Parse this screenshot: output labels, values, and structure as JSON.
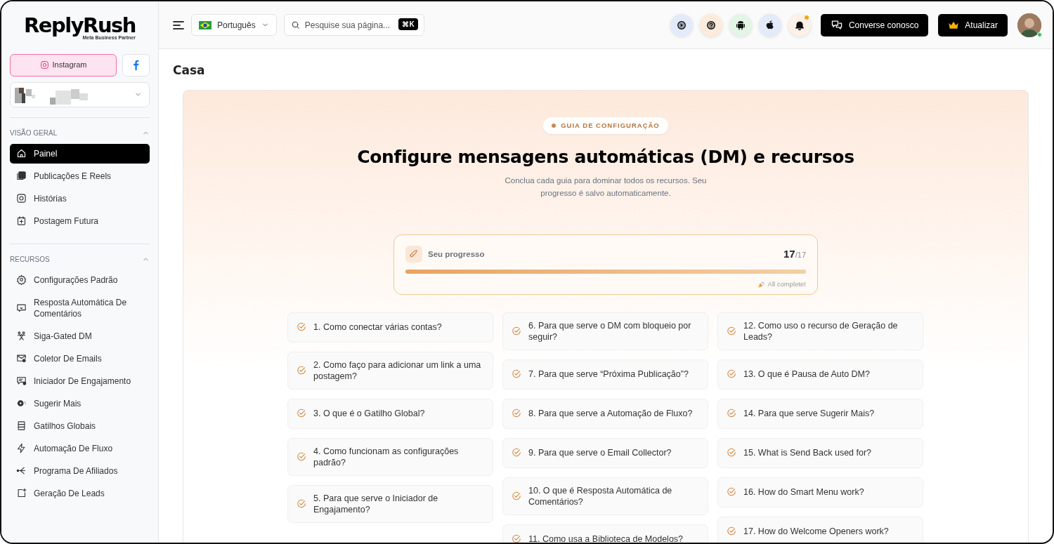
{
  "brand": {
    "name": "ReplyRush",
    "tagline": "Meta Business Partner"
  },
  "platform_tabs": [
    {
      "kind": "instagram",
      "label": "Instagram",
      "selected": true
    },
    {
      "kind": "facebook",
      "selected": false
    }
  ],
  "sidebar": {
    "sections": [
      {
        "title": "VISÃO GERAL",
        "expanded": true,
        "items": [
          {
            "label": "Painel",
            "selected": true
          },
          {
            "label": "Publicações E Reels",
            "selected": false
          },
          {
            "label": "Histórias",
            "selected": false
          },
          {
            "label": "Postagem Futura",
            "selected": false
          }
        ]
      },
      {
        "title": "RECURSOS",
        "expanded": true,
        "items": [
          {
            "label": "Configurações Padrão",
            "selected": false
          },
          {
            "label": "Resposta Automática De Comentários",
            "selected": false
          },
          {
            "label": "Siga-Gated DM",
            "selected": false
          },
          {
            "label": "Coletor De Emails",
            "selected": false
          },
          {
            "label": "Iniciador De Engajamento",
            "selected": false
          },
          {
            "label": "Sugerir Mais",
            "selected": false
          },
          {
            "label": "Gatilhos Globais",
            "selected": false
          },
          {
            "label": "Automação De Fluxo",
            "selected": false
          },
          {
            "label": "Programa De Afiliados",
            "selected": false
          },
          {
            "label": "Geração De Leads",
            "selected": false
          }
        ]
      }
    ]
  },
  "topbar": {
    "language": {
      "label": "Português"
    },
    "search": {
      "placeholder": "Pesquise sua página...",
      "shortcut": "⌘K"
    },
    "icon_buttons": [
      {
        "kind": "video"
      },
      {
        "kind": "help"
      },
      {
        "kind": "android"
      },
      {
        "kind": "apple"
      },
      {
        "kind": "notifications",
        "unread": true
      }
    ],
    "buttons": [
      {
        "kind": "chat",
        "label": "Converse conosco"
      },
      {
        "kind": "upgrade",
        "label": "Atualizar"
      }
    ],
    "user": {
      "online": true
    }
  },
  "page_title": "Casa",
  "guide": {
    "badge": "GUIA DE CONFIGURAÇÃO",
    "title": "Configure mensagens automáticas (DM) e recursos",
    "subtitle": "Conclua cada guia para dominar todos os recursos. Seu progresso é salvo automaticamente.",
    "progress": {
      "label": "Seu progresso",
      "done": "17",
      "total": "/17",
      "level": 1,
      "note": "All complete!"
    },
    "columns": [
      [
        {
          "text": "1. Como conectar várias contas?",
          "done": true
        },
        {
          "text": "2. Como faço para adicionar um link a uma postagem?",
          "done": true
        },
        {
          "text": "3. O que é o Gatilho Global?",
          "done": true
        },
        {
          "text": "4. Como funcionam as configurações padrão?",
          "done": true
        },
        {
          "text": "5. Para que serve o Iniciador de Engajamento?",
          "done": true
        }
      ],
      [
        {
          "text": "6. Para que serve o DM com bloqueio por seguir?",
          "done": true
        },
        {
          "text": "7. Para que serve “Próxima Publicação”?",
          "done": true
        },
        {
          "text": "8. Para que serve a Automação de Fluxo?",
          "done": true
        },
        {
          "text": "9. Para que serve o Email Collector?",
          "done": true
        },
        {
          "text": "10. O que é Resposta Automática de Comentários?",
          "done": true
        },
        {
          "text": "11. Como usa a Biblioteca de Modelos?",
          "done": true
        }
      ],
      [
        {
          "text": "12. Como uso o recurso de Geração de Leads?",
          "done": true
        },
        {
          "text": "13. O que é Pausa de Auto DM?",
          "done": true
        },
        {
          "text": "14. Para que serve Sugerir Mais?",
          "done": true
        },
        {
          "text": "15. What is Send Back used for?",
          "done": true
        },
        {
          "text": "16. How do Smart Menu work?",
          "done": true
        },
        {
          "text": "17. How do Welcome Openers work?",
          "done": true
        }
      ]
    ]
  }
}
